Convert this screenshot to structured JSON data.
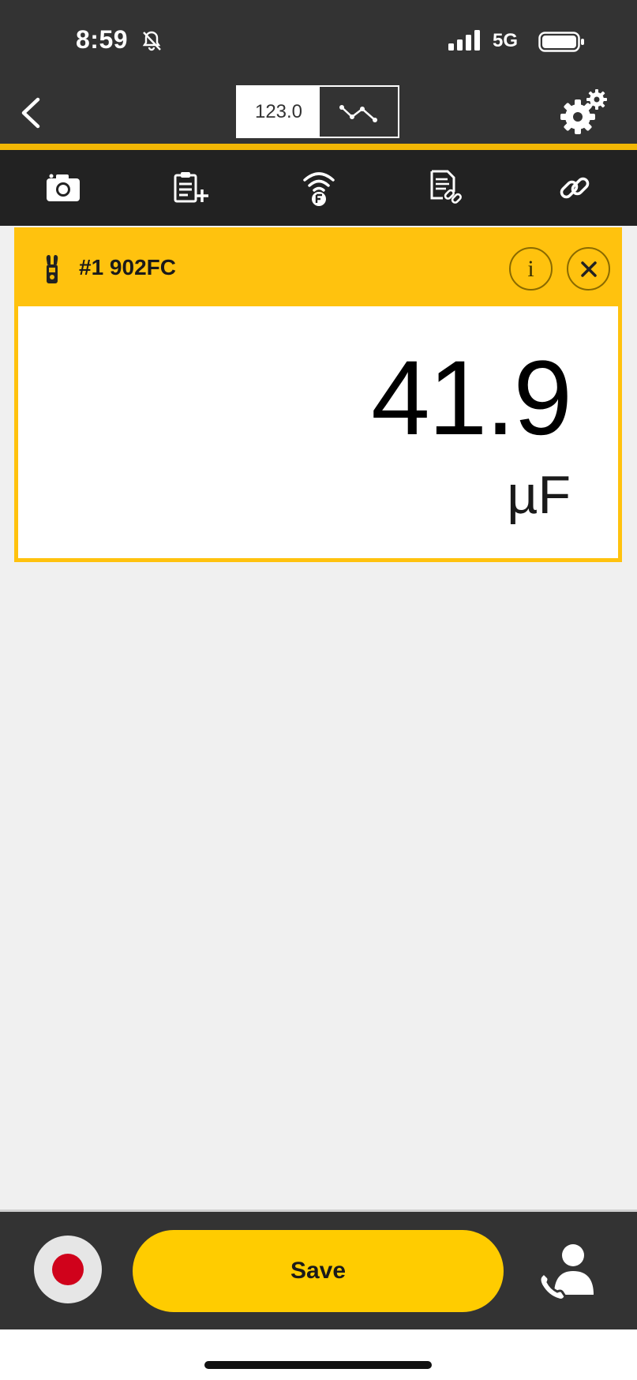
{
  "status_bar": {
    "time": "8:59",
    "network": "5G",
    "icons": [
      "bell-slash-icon",
      "signal-icon",
      "battery-icon"
    ]
  },
  "nav": {
    "view_numeric_label": "123.0",
    "view_graph_icon": "trend-line-icon",
    "back_icon": "chevron-left-icon",
    "settings_icon": "gears-icon"
  },
  "toolbar": {
    "items": [
      {
        "icon": "camera-icon"
      },
      {
        "icon": "clipboard-add-icon"
      },
      {
        "icon": "wireless-connect-icon"
      },
      {
        "icon": "document-link-icon"
      },
      {
        "icon": "link-icon"
      }
    ]
  },
  "meter": {
    "name": "#1 902FC",
    "reading": "41.9",
    "unit": "µF",
    "info_label": "i"
  },
  "bottom": {
    "save_label": "Save",
    "record_icon": "record-icon",
    "support_icon": "support-call-icon"
  },
  "colors": {
    "accent": "#ffc20e",
    "save_button": "#ffcc00",
    "bar_background": "#333333",
    "toolbar_background": "#222222",
    "record": "#d0021b"
  }
}
